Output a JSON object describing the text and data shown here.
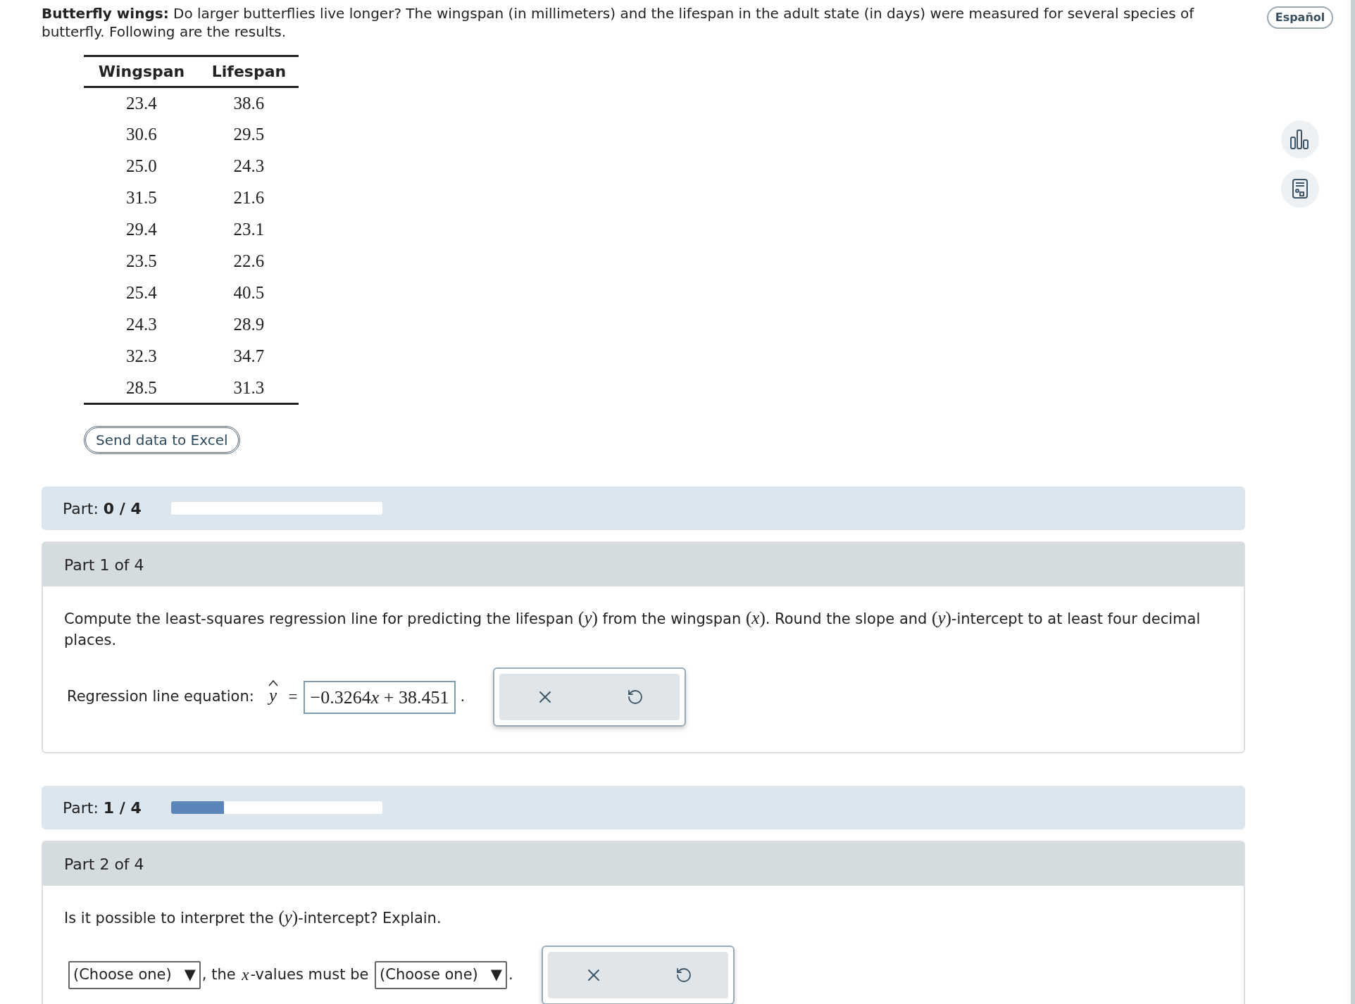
{
  "intro": "**Butterfly wings:** Do larger butterflies live longer? The wingspan (in millimeters) and the lifespan in the adult state (in days) were measured for several species of butterfly. Following are the results.",
  "language_button": "Español",
  "table": {
    "columns": [
      "Wingspan",
      "Lifespan"
    ],
    "rows": [
      [
        "23.4",
        "38.6"
      ],
      [
        "30.6",
        "29.5"
      ],
      [
        "25.0",
        "24.3"
      ],
      [
        "31.5",
        "21.6"
      ],
      [
        "29.4",
        "23.1"
      ],
      [
        "23.5",
        "22.6"
      ],
      [
        "25.4",
        "40.5"
      ],
      [
        "24.3",
        "28.9"
      ],
      [
        "32.3",
        "34.7"
      ],
      [
        "28.5",
        "31.3"
      ]
    ]
  },
  "excel_button": "Send data to Excel",
  "parts": [
    {
      "progress": {
        "label": "Part:",
        "value": "0 / 4",
        "level": 0
      },
      "header": "Part 1 of 4",
      "question": [
        {
          "kind": "text",
          "text": "Compute the least-squares regression line for predicting the lifespan "
        },
        {
          "kind": "math",
          "text": "(*y*)"
        },
        {
          "kind": "text",
          "text": " from the wingspan "
        },
        {
          "kind": "math",
          "text": "(*x*)"
        },
        {
          "kind": "text",
          "text": ". Round the slope and "
        },
        {
          "kind": "math",
          "text": "(*y*)"
        },
        {
          "kind": "text",
          "text": "-intercept to at least four decimal places."
        }
      ],
      "answer": [
        {
          "kind": "text",
          "text": "Regression line equation: "
        },
        {
          "kind": "hat",
          "text": "y"
        },
        {
          "kind": "math",
          "text": "="
        },
        {
          "kind": "value",
          "parts": [
            {
              "text": "−0.3264",
              "italic": false
            },
            {
              "text": "x",
              "italic": true
            },
            {
              "text": " + 38.451",
              "italic": false
            }
          ]
        },
        {
          "kind": "text",
          "text": "."
        }
      ]
    },
    {
      "progress": {
        "label": "Part:",
        "value": "1 / 4",
        "level": 0.25
      },
      "header": "Part 2 of 4",
      "question": [
        {
          "kind": "text",
          "text": "Is it possible to interpret the "
        },
        {
          "kind": "math",
          "text": "(*y*)"
        },
        {
          "kind": "text",
          "text": "-intercept? Explain."
        }
      ],
      "answer": [
        {
          "kind": "select",
          "text": "(Choose one)",
          "arrow": "▼"
        },
        {
          "kind": "text",
          "text": ", the "
        },
        {
          "kind": "math",
          "text": "*x*"
        },
        {
          "kind": "text",
          "text": "-values must be "
        },
        {
          "kind": "select",
          "text": "(Choose one)",
          "arrow": "▼"
        },
        {
          "kind": "text",
          "text": "."
        }
      ]
    }
  ]
}
